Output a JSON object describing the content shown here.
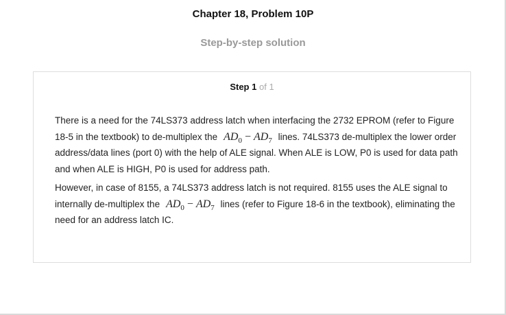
{
  "header": {
    "title": "Chapter 18, Problem 10P",
    "subtitle": "Step-by-step solution"
  },
  "step": {
    "word": "Step",
    "number": "1",
    "of_total": "of 1"
  },
  "math": {
    "ad": "AD",
    "sub_start": "0",
    "minus": "−",
    "sub_end": "7"
  },
  "paragraphs": {
    "p1": {
      "part1": "There is a need for the 74LS373 address latch when interfacing the 2732 EPROM (refer to Figure 18-5 in the textbook) to de-multiplex the",
      "part2": "lines. 74LS373 de-multiplex the lower order address/data lines (port 0) with the help of ALE signal. When ALE is LOW, P0 is used for data path and when ALE is HIGH, P0 is used for address path."
    },
    "p2": {
      "part1": "However, in case of 8155, a 74LS373 address latch is not required. 8155 uses the ALE signal to internally de-multiplex the",
      "part2": "lines (refer to Figure 18-6 in the textbook), eliminating the need for an address latch IC."
    }
  }
}
